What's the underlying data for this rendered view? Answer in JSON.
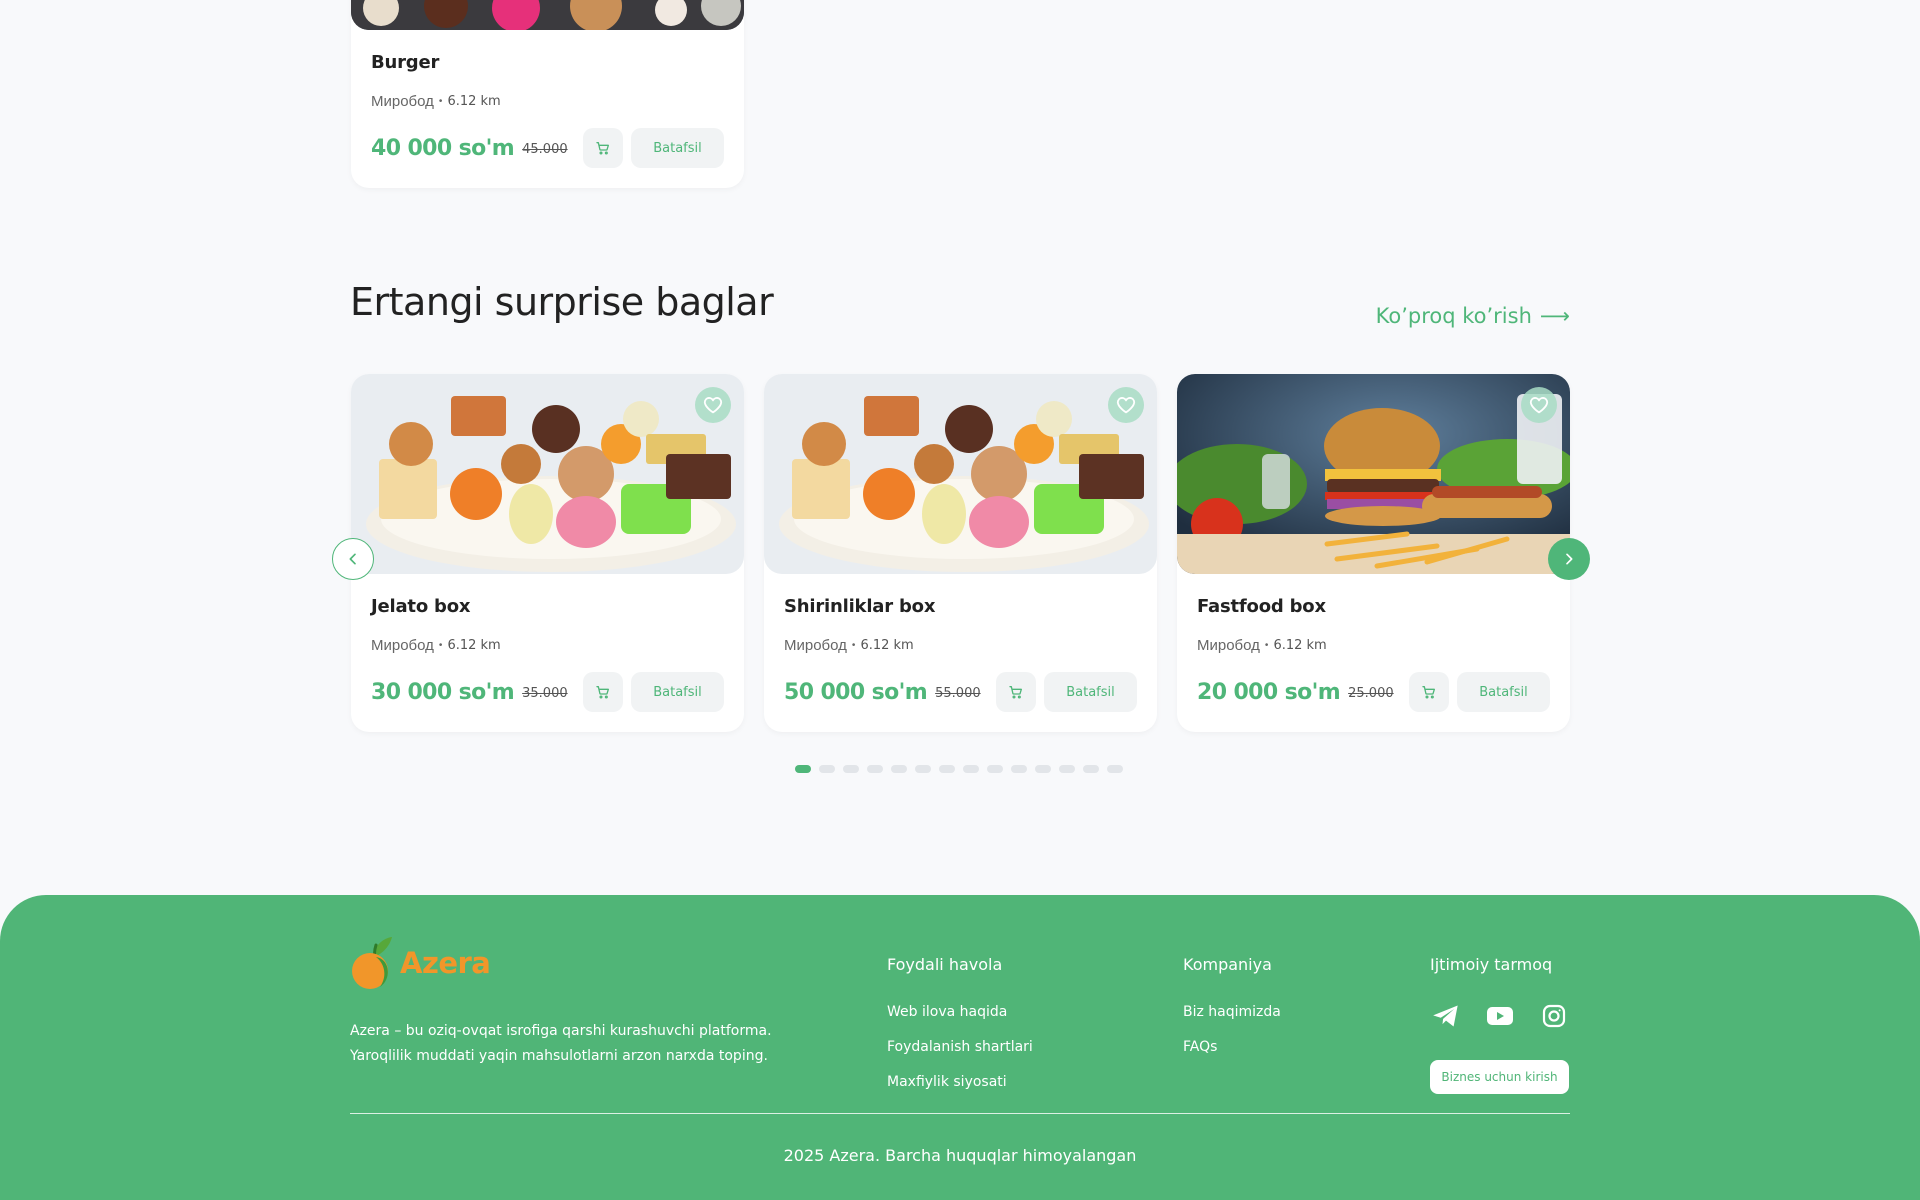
{
  "top_card": {
    "title": "Burger",
    "location": "Миробод",
    "distance": "6.12 km",
    "price": "40 000 so'm",
    "old_price": "45.000",
    "details_label": "Batafsil"
  },
  "section": {
    "title": "Ertangi surprise baglar",
    "see_more": "Ko’proq ko’rish",
    "arrow": "⟶"
  },
  "cards": [
    {
      "title": "Jelato box",
      "location": "Миробод",
      "distance": "6.12 km",
      "price": "30 000 so'm",
      "old_price": "35.000",
      "details_label": "Batafsil",
      "image": "sweets-platter"
    },
    {
      "title": "Shirinliklar box",
      "location": "Миробод",
      "distance": "6.12 km",
      "price": "50 000 so'm",
      "old_price": "55.000",
      "details_label": "Batafsil",
      "image": "sweets-platter"
    },
    {
      "title": "Fastfood box",
      "location": "Миробод",
      "distance": "6.12 km",
      "price": "20 000 so'm",
      "old_price": "25.000",
      "details_label": "Batafsil",
      "image": "burger-fastfood"
    }
  ],
  "pagination": {
    "total": 14,
    "active": 0
  },
  "footer": {
    "logo_text": "Azera",
    "description_line1": "Azera – bu oziq-ovqat isrofiga qarshi kurashuvchi platforma.",
    "description_line2": "Yaroqlilik muddati yaqin mahsulotlarni arzon narxda toping.",
    "columns": [
      {
        "title": "Foydali havola",
        "links": [
          "Web ilova haqida",
          "Foydalanish shartlari",
          "Maxfiylik siyosati"
        ]
      },
      {
        "title": "Kompaniya",
        "links": [
          "Biz haqimizda",
          "FAQs"
        ]
      }
    ],
    "social_title": "Ijtimoiy tarmoq",
    "social_icons": [
      "telegram-icon",
      "youtube-icon",
      "instagram-icon"
    ],
    "business_button": "Biznes uchun kirish",
    "copyright": "2025 Azera. Barcha huquqlar himoyalangan"
  },
  "colors": {
    "accent": "#4fb679",
    "footer_bg": "#50b577",
    "logo_orange": "#f1962a",
    "page_bg": "#f8f9fb"
  }
}
